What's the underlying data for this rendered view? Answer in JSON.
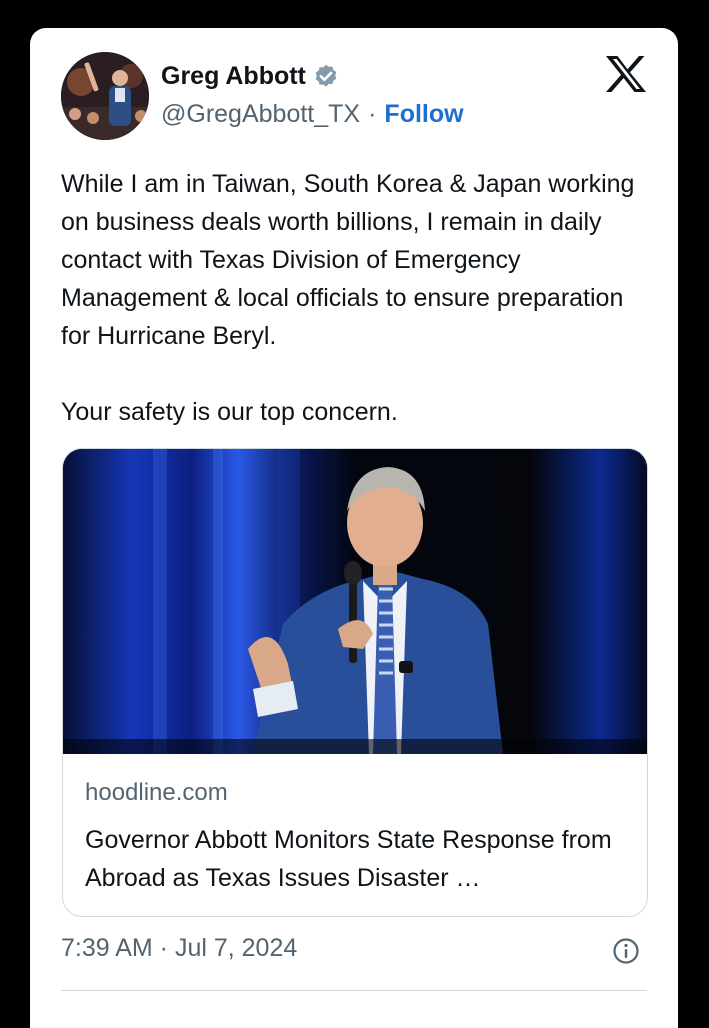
{
  "tweet": {
    "author_name": "Greg Abbott",
    "handle": "@GregAbbott_TX",
    "separator": "·",
    "follow_label": "Follow",
    "text_paragraph_1": "While I am in Taiwan, South Korea & Japan working on business deals worth billions, I remain in daily contact with Texas Division of Emergency Management & local officials to ensure preparation for Hurricane Beryl.",
    "text_paragraph_2": "Your safety is our top concern.",
    "timestamp": "7:39 AM · Jul 7, 2024"
  },
  "link_card": {
    "domain": "hoodline.com",
    "title": "Governor Abbott Monitors State Response from Abroad as Texas Issues Disaster …"
  },
  "icons": {
    "verified": "verified-badge-icon",
    "brand": "x-logo-icon",
    "info": "info-icon"
  },
  "colors": {
    "background": "#000000",
    "card": "#ffffff",
    "text_primary": "#0f1419",
    "text_secondary": "#536471",
    "follow": "#1d6fd0",
    "border": "#cfd9de",
    "verified_badge": "#829aab"
  }
}
